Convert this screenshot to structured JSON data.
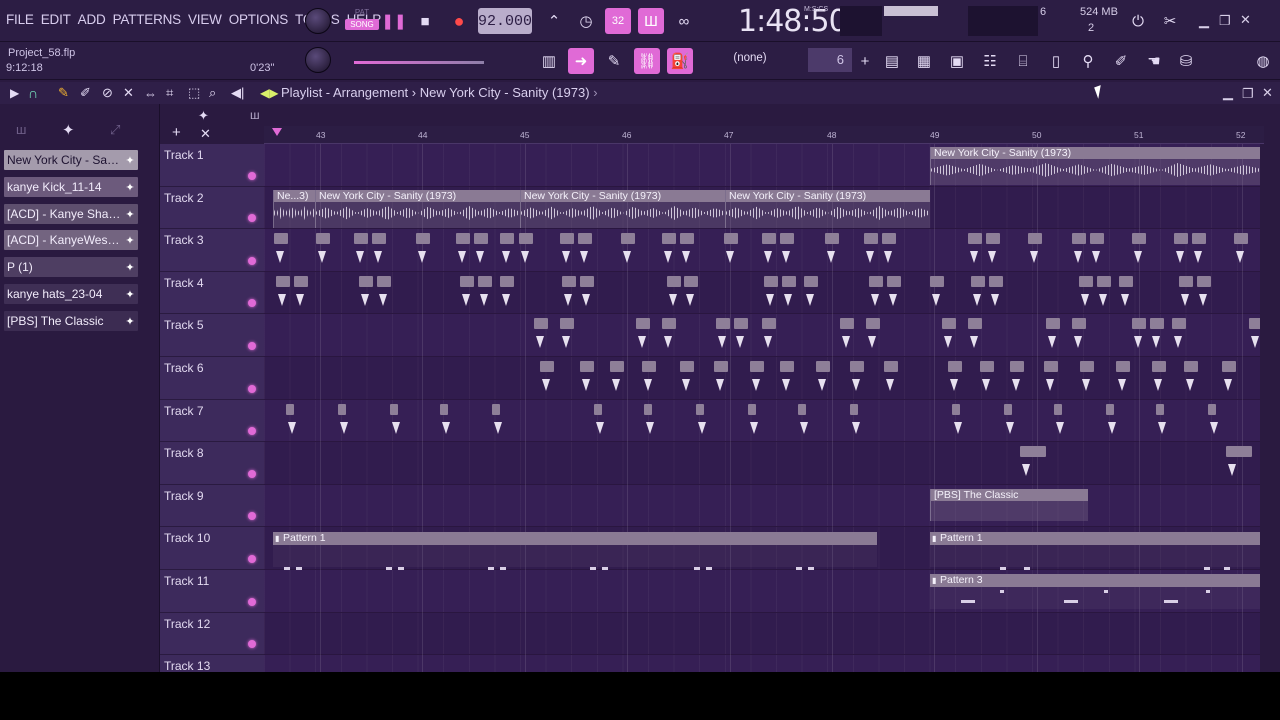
{
  "menu": [
    "FILE",
    "EDIT",
    "ADD",
    "PATTERNS",
    "VIEW",
    "OPTIONS",
    "TOOLS",
    "HELP"
  ],
  "transport": {
    "pat_label": "PAT",
    "song_label": "SONG",
    "tempo": "92.000",
    "time": "1:48:50",
    "time_unit": "M:S:CS"
  },
  "project": {
    "name": "Project_58.flp",
    "time": "9:12:18",
    "position": "0'23\""
  },
  "snap": "(none)",
  "step": "6",
  "system": {
    "cpu_top": "6",
    "cpu_bottom": "2",
    "memory": "524 MB"
  },
  "playlist": {
    "title": "Playlist - Arrangement",
    "separator": "›",
    "pattern": "New York City - Sanity (1973)"
  },
  "browser_items": [
    {
      "label": "New York City - Sani...",
      "color": "#a49bac"
    },
    {
      "label": "kanye Kick_11-14",
      "color": "#6c5a7c"
    },
    {
      "label": "[ACD] - Kanye Shaker",
      "color": "#5e4f6e"
    },
    {
      "label": "[ACD] - KanyeWest S...",
      "color": "#736480"
    },
    {
      "label": "P (1)",
      "color": "#4e3e62"
    },
    {
      "label": "kanye hats_23-04",
      "color": "#3f2f55"
    },
    {
      "label": "[PBS] The Classic",
      "color": "#3c2c52"
    }
  ],
  "ruler_ticks": [
    "43",
    "44",
    "45",
    "46",
    "47",
    "48",
    "49",
    "50",
    "51",
    "52"
  ],
  "tracks": [
    "Track 1",
    "Track 2",
    "Track 3",
    "Track 4",
    "Track 5",
    "Track 6",
    "Track 7",
    "Track 8",
    "Track 9",
    "Track 10",
    "Track 11",
    "Track 12",
    "Track 13"
  ],
  "clips": {
    "t1": "New York City - Sanity (1973)",
    "t2a": "Ne...3)",
    "t2b": "New York City - Sanity (1973)",
    "t2c": "New York City - Sanity (1973)",
    "t2d": "New York City - Sanity (1973)",
    "t9": "[PBS] The Classic",
    "t10a": "Pattern 1",
    "t10b": "Pattern 1",
    "t11": "Pattern 3"
  }
}
